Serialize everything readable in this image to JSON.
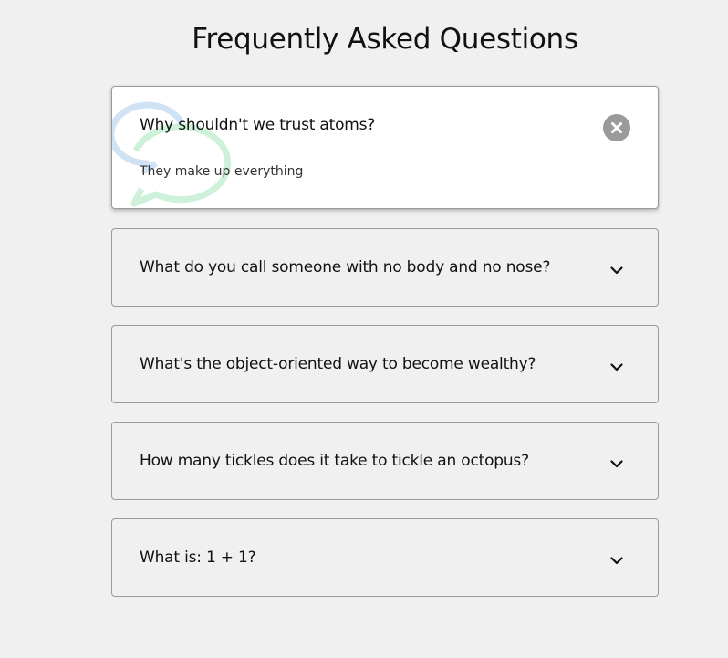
{
  "page": {
    "title": "Frequently Asked Questions"
  },
  "faqs": [
    {
      "question": "Why shouldn't we trust atoms?",
      "answer": "They make up everything",
      "expanded": true
    },
    {
      "question": "What do you call someone with no body and no nose?",
      "expanded": false
    },
    {
      "question": "What's the object-oriented way to become wealthy?",
      "expanded": false
    },
    {
      "question": "How many tickles does it take to tickle an octopus?",
      "expanded": false
    },
    {
      "question": "What is: 1 + 1?",
      "expanded": false
    }
  ],
  "icons": {
    "close": "close-icon",
    "chevron": "chevron-down-icon",
    "decoration": "chat-bubbles-icon"
  },
  "colors": {
    "background": "#f0f0f0",
    "card_active": "#ffffff",
    "border": "#9a9a9a",
    "close_button": "#9a9a9a",
    "bubble_blue": "#cfe3f5",
    "bubble_green": "#c9f0d6"
  }
}
